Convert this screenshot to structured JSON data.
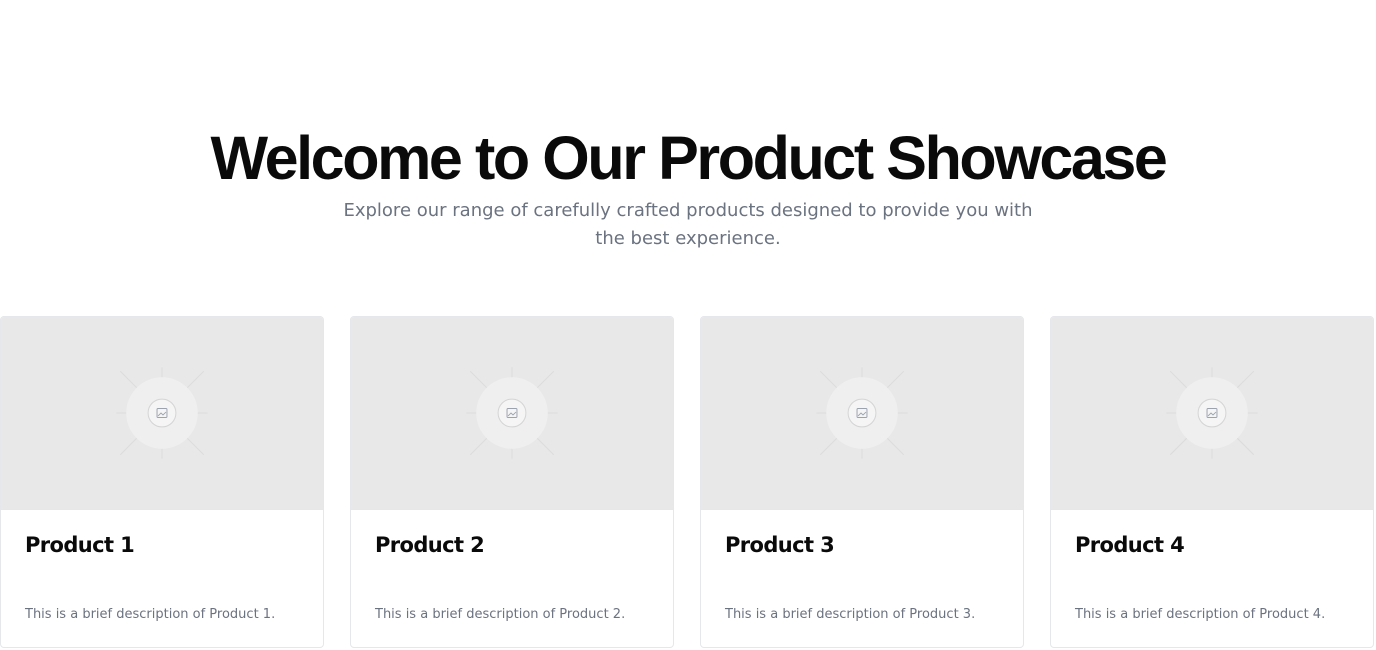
{
  "hero": {
    "title": "Welcome to Our Product Showcase",
    "subtitle": "Explore our range of carefully crafted products designed to provide you with the best experience."
  },
  "products": [
    {
      "title": "Product 1",
      "description": "This is a brief description of Product 1.",
      "image_icon": "image-placeholder-icon"
    },
    {
      "title": "Product 2",
      "description": "This is a brief description of Product 2.",
      "image_icon": "image-placeholder-icon"
    },
    {
      "title": "Product 3",
      "description": "This is a brief description of Product 3.",
      "image_icon": "image-placeholder-icon"
    },
    {
      "title": "Product 4",
      "description": "This is a brief description of Product 4.",
      "image_icon": "image-placeholder-icon"
    }
  ],
  "colors": {
    "title": "#0a0a0a",
    "muted_text": "#6b7280",
    "placeholder_bg": "#e8e8e8",
    "card_border": "#e5e7eb"
  }
}
